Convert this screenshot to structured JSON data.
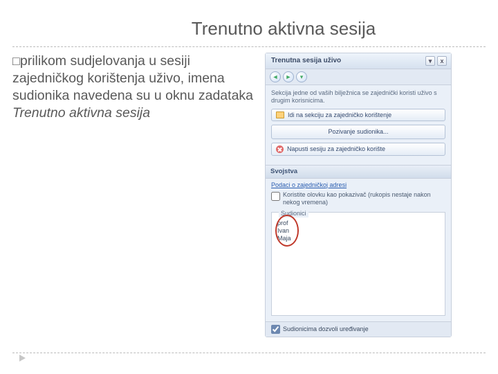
{
  "title": "Trenutno aktivna sesija",
  "bullet": {
    "mark": "□",
    "lead": "prilikom ",
    "rest": "sudjelovanja u sesiji zajedničkog korištenja uživo, imena sudionika navedena su u oknu zadataka ",
    "italic": "Trenutno aktivna sesija"
  },
  "pane": {
    "header": "Trenutna sesija uživo",
    "drop_glyph": "▾",
    "close_glyph": "x",
    "nav": {
      "back_glyph": "◄",
      "fwd_glyph": "►",
      "home_glyph": "▾"
    },
    "desc": "Sekcija jedne od vaših bilježnica se zajednički koristi uživo s drugim korisnicima.",
    "btn_go_section": "Idi na sekciju za zajedničko korištenje",
    "btn_invite": "Pozivanje sudionika...",
    "btn_leave": "Napusti sesiju za zajedničko korište",
    "section_props": "Svojstva",
    "link_share_info": "Podaci o zajedničkoj adresi",
    "chk_pointer": "Koristite olovku kao pokazivač (rukopis nestaje nakon nekog vremena)",
    "participants_label": "Sudionici",
    "participants": [
      "prof",
      "Ivan",
      "Maja"
    ],
    "chk_allow_edit": "Sudionicima dozvoli uređivanje"
  }
}
